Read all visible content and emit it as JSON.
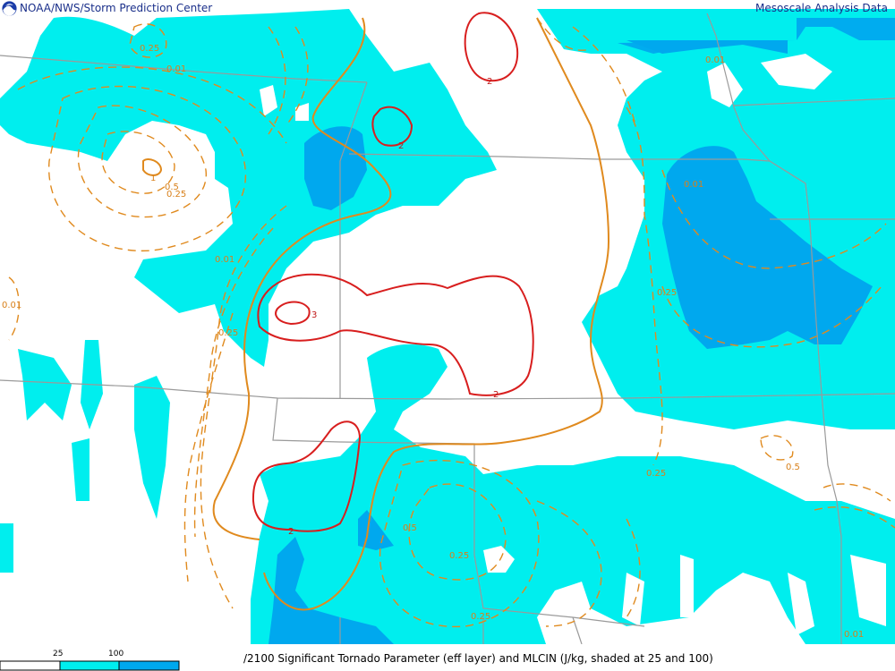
{
  "header": {
    "source": "NOAA/NWS/Storm Prediction Center",
    "product": "Mesoscale Analysis Data"
  },
  "footer": {
    "caption": "/2100 Significant Tornado Parameter (eff layer) and MLCIN (J/kg, shaded at 25 and 100)"
  },
  "legend": {
    "ticks": [
      "25",
      "100"
    ],
    "colors": [
      "#ffffff",
      "#00eeee",
      "#00a8ee"
    ]
  },
  "colors": {
    "cin_light": "#00eeee",
    "cin_dark": "#00a8ee",
    "stp_contour": "#d81e1e",
    "stp_low_contour": "#e08a1e",
    "borders": "#9a9a9a"
  },
  "contour_labels": {
    "orange": [
      "0.25",
      "0.01",
      "1",
      "0.5",
      "0.25",
      "0.01",
      "0.01",
      "0.25",
      "0.01",
      "0.25",
      "0.5",
      "0.25",
      "0.5",
      "0.25",
      "0.25",
      "0.01",
      "0.01"
    ],
    "red": [
      "2",
      "2",
      "3",
      "2",
      "2"
    ]
  },
  "icons": {
    "logo": "noaa-logo-icon"
  }
}
